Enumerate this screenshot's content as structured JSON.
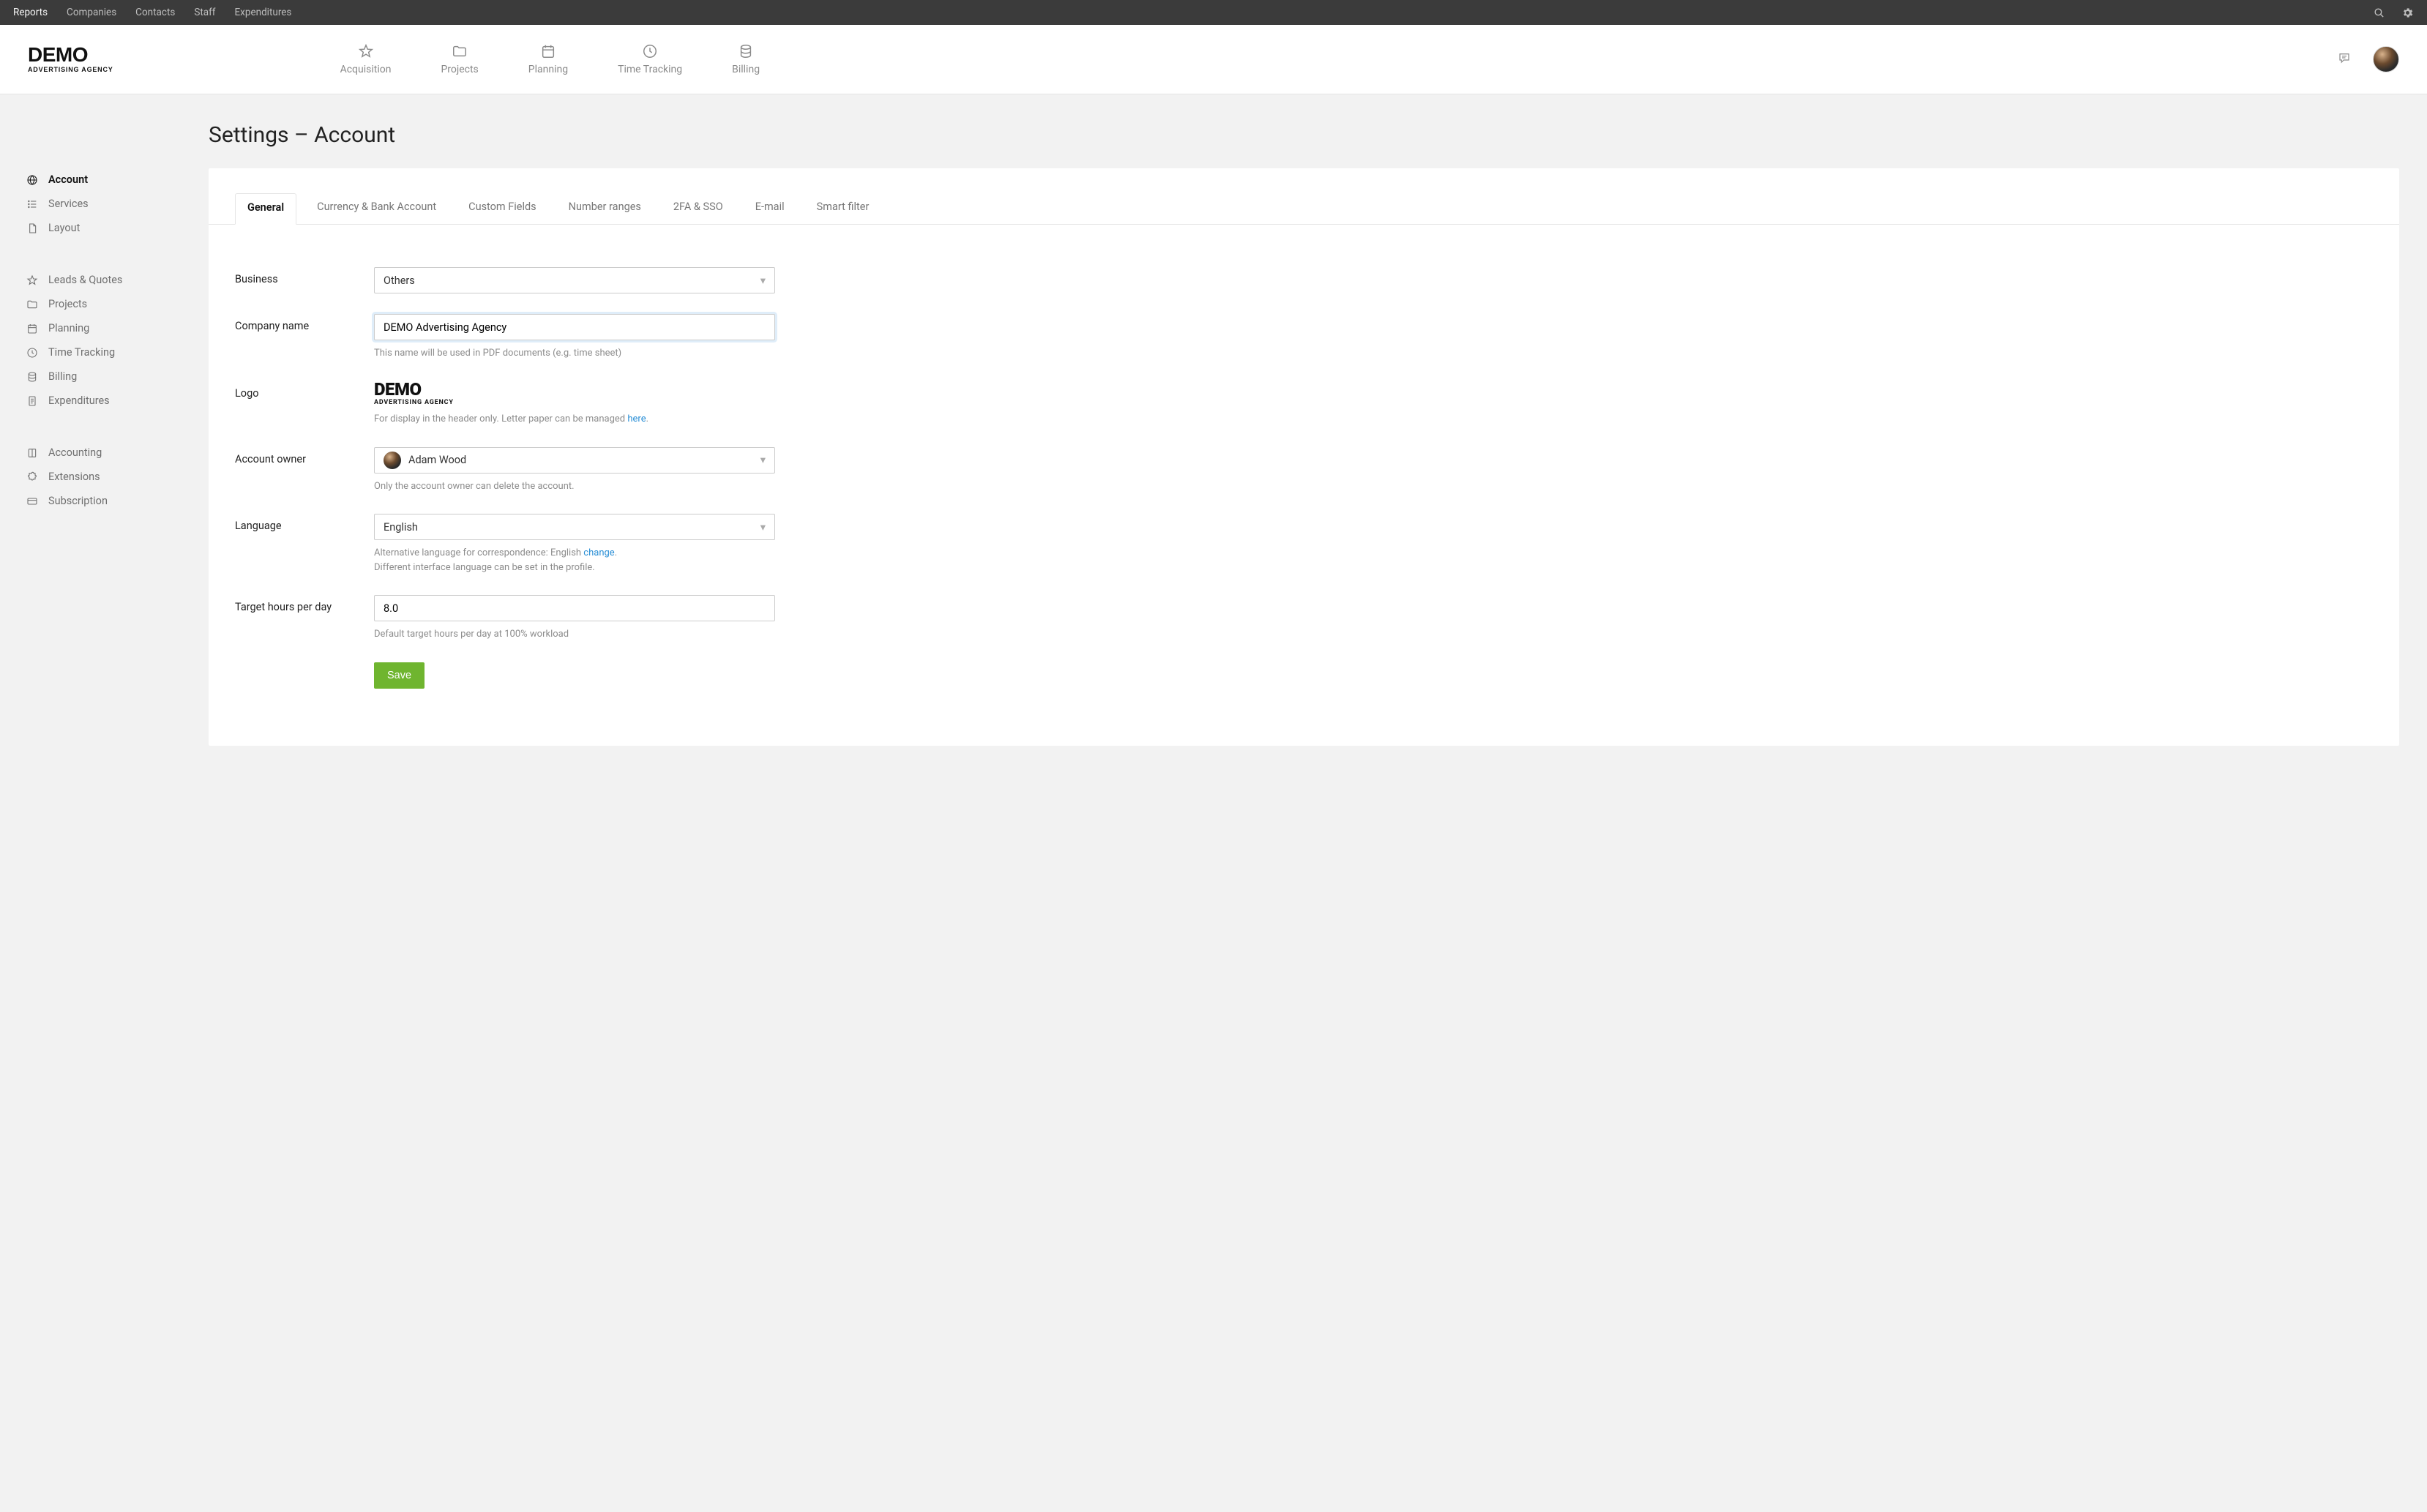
{
  "topnav": {
    "items": [
      "Reports",
      "Companies",
      "Contacts",
      "Staff",
      "Expenditures"
    ],
    "active_index": 0
  },
  "brand": {
    "name": "DEMO",
    "tagline": "ADVERTISING AGENCY"
  },
  "mainnav": {
    "items": [
      {
        "label": "Acquisition"
      },
      {
        "label": "Projects"
      },
      {
        "label": "Planning"
      },
      {
        "label": "Time Tracking"
      },
      {
        "label": "Billing"
      }
    ]
  },
  "page": {
    "title": "Settings – Account"
  },
  "sidebar": {
    "groups": [
      [
        "Account",
        "Services",
        "Layout"
      ],
      [
        "Leads & Quotes",
        "Projects",
        "Planning",
        "Time Tracking",
        "Billing",
        "Expenditures"
      ],
      [
        "Accounting",
        "Extensions",
        "Subscription"
      ]
    ],
    "active": "Account"
  },
  "tabs": {
    "items": [
      "General",
      "Currency & Bank Account",
      "Custom Fields",
      "Number ranges",
      "2FA & SSO",
      "E-mail",
      "Smart filter"
    ],
    "active_index": 0
  },
  "form": {
    "business": {
      "label": "Business",
      "value": "Others"
    },
    "company": {
      "label": "Company name",
      "value": "DEMO Advertising Agency",
      "help": "This name will be used in PDF documents (e.g. time sheet)"
    },
    "logo": {
      "label": "Logo",
      "help_prefix": "For display in the header only. Letter paper can be managed ",
      "help_link": "here",
      "help_suffix": "."
    },
    "owner": {
      "label": "Account owner",
      "value": "Adam Wood",
      "help": "Only the account owner can delete the account."
    },
    "language": {
      "label": "Language",
      "value": "English",
      "help_line1_prefix": "Alternative language for correspondence: English ",
      "help_line1_link": "change",
      "help_line1_suffix": ".",
      "help_line2": "Different interface language can be set in the profile."
    },
    "target_hours": {
      "label": "Target hours per day",
      "value": "8.0",
      "help": "Default target hours per day at 100% workload"
    },
    "save_label": "Save"
  }
}
